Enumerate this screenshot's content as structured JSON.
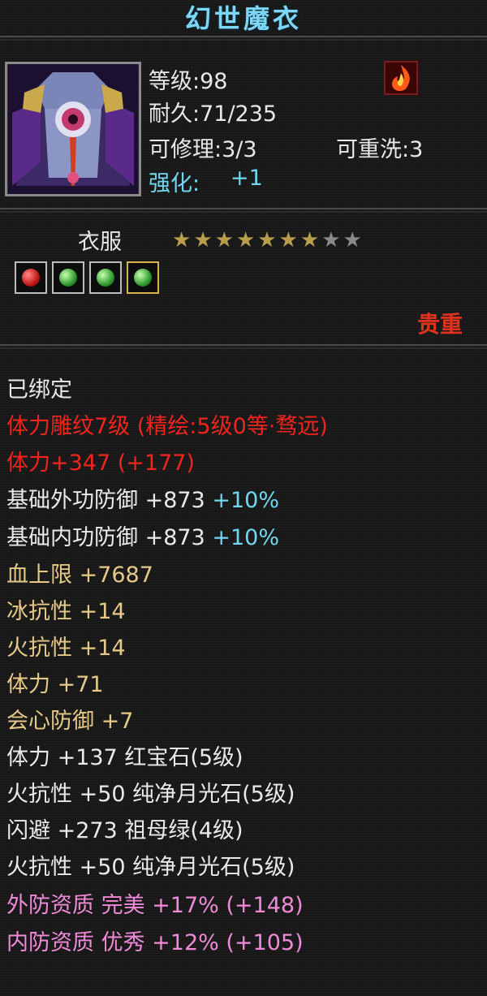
{
  "item": {
    "name": "幻世魔衣",
    "level": "等级:98",
    "durability": "耐久:71/235",
    "repairable": "可修理:3/3",
    "rewash": "可重洗:3",
    "enhance_label": "强化:",
    "enhance_value": "+1",
    "category": "衣服",
    "stars_total": 9,
    "stars_filled": 7,
    "rarity": "贵重"
  },
  "gems": [
    {
      "type": "red",
      "selected": false
    },
    {
      "type": "green",
      "selected": false
    },
    {
      "type": "green",
      "selected": false
    },
    {
      "type": "green",
      "selected": true
    }
  ],
  "attributes": {
    "bound": "已绑定",
    "engrave": "体力雕纹7级 (精绘:5级0等·骛远)",
    "stamina_bonus": "体力+347 (+177)",
    "ext_def_label": "基础外功防御 +873",
    "ext_def_pct": "+10%",
    "int_def_label": "基础内功防御 +873",
    "int_def_pct": "+10%",
    "hp": "血上限 +7687",
    "ice_res": "冰抗性 +14",
    "fire_res": "火抗性 +14",
    "stamina": "体力 +71",
    "crit_def": "会心防御 +7",
    "gem1": "体力 +137 红宝石(5级)",
    "gem2": "火抗性 +50 纯净月光石(5级)",
    "gem3": "闪避 +273 祖母绿(4级)",
    "gem4": "火抗性 +50 纯净月光石(5级)",
    "ext_quality": "外防资质  完美 +17% (+148)",
    "int_quality": "内防资质  优秀 +12% (+105)"
  },
  "colors": {
    "title": "#7fd6f2",
    "cyan": "#6fd8ef",
    "red": "#f0241c",
    "gold": "#e6c987",
    "pink": "#f08ad8",
    "rarity": "#e0331f"
  }
}
